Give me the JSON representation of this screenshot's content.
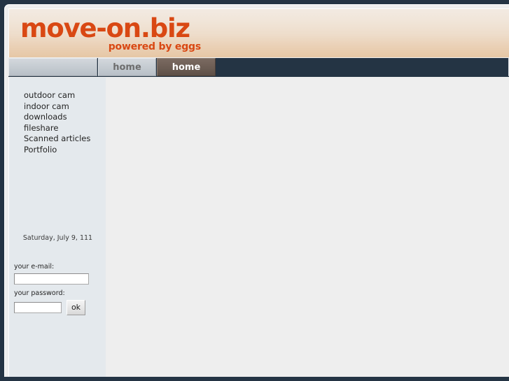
{
  "site": {
    "logo_text": "move-on.biz",
    "logo_tagline": "powered by eggs",
    "logo_color": "#d94813"
  },
  "tabs": {
    "filler_label": "",
    "items": [
      {
        "label": "home",
        "state": "inactive"
      },
      {
        "label": "home",
        "state": "active"
      }
    ],
    "edge_label": "",
    "bar_color": "#243444"
  },
  "sidebar": {
    "background": "#e4e9ed",
    "nav_items": [
      {
        "label": "outdoor cam"
      },
      {
        "label": "indoor cam"
      },
      {
        "label": "downloads"
      },
      {
        "label": "fileshare"
      },
      {
        "label": "Scanned articles"
      },
      {
        "label": "Portfolio"
      }
    ],
    "date_text": "Saturday, July 9, 111",
    "login": {
      "email_label": "your e-mail:",
      "email_value": "",
      "password_label": "your password:",
      "password_value": "",
      "submit_label": "ok"
    }
  },
  "main": {
    "background": "#eeeeee",
    "content": ""
  }
}
